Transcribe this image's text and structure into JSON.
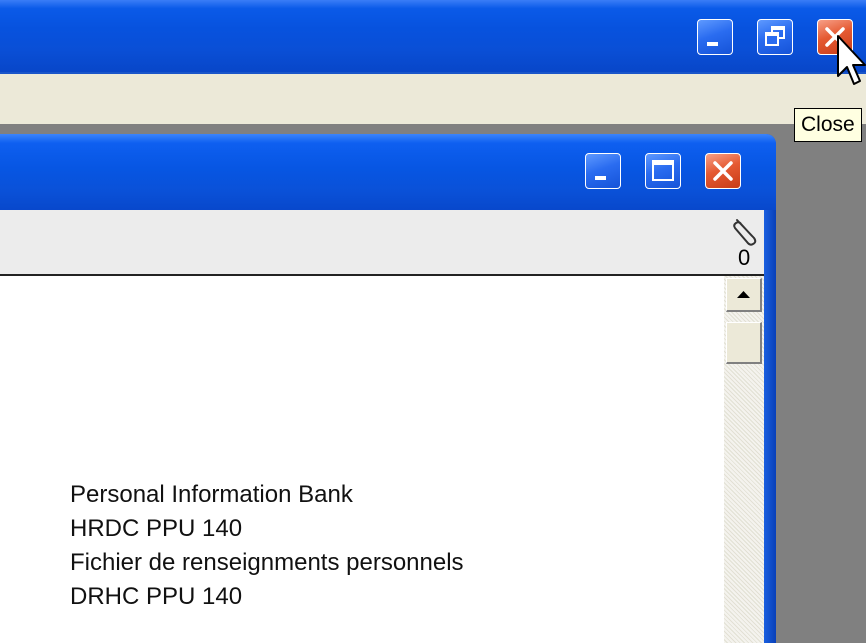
{
  "outer_window": {
    "buttons": {
      "minimize_icon": "minimize-icon",
      "restore_icon": "restore-icon",
      "close_icon": "close-icon"
    },
    "tooltip": "Close"
  },
  "inner_window": {
    "buttons": {
      "minimize_icon": "minimize-icon",
      "maximize_icon": "maximize-icon",
      "close_icon": "close-icon"
    },
    "attachment": {
      "icon": "paperclip-icon",
      "count": "0"
    },
    "document": {
      "lines": [
        "Personal Information Bank",
        "HRDC PPU 140",
        "Fichier de renseignments personnels",
        "DRHC PPU 140"
      ]
    },
    "scrollbar": {
      "up_icon": "arrow-up-icon"
    }
  },
  "colors": {
    "titlebar_blue": "#0a55dc",
    "close_red": "#e0542b",
    "menubar": "#ece9d8",
    "workspace": "#808080",
    "tooltip_bg": "#ffffe1"
  }
}
